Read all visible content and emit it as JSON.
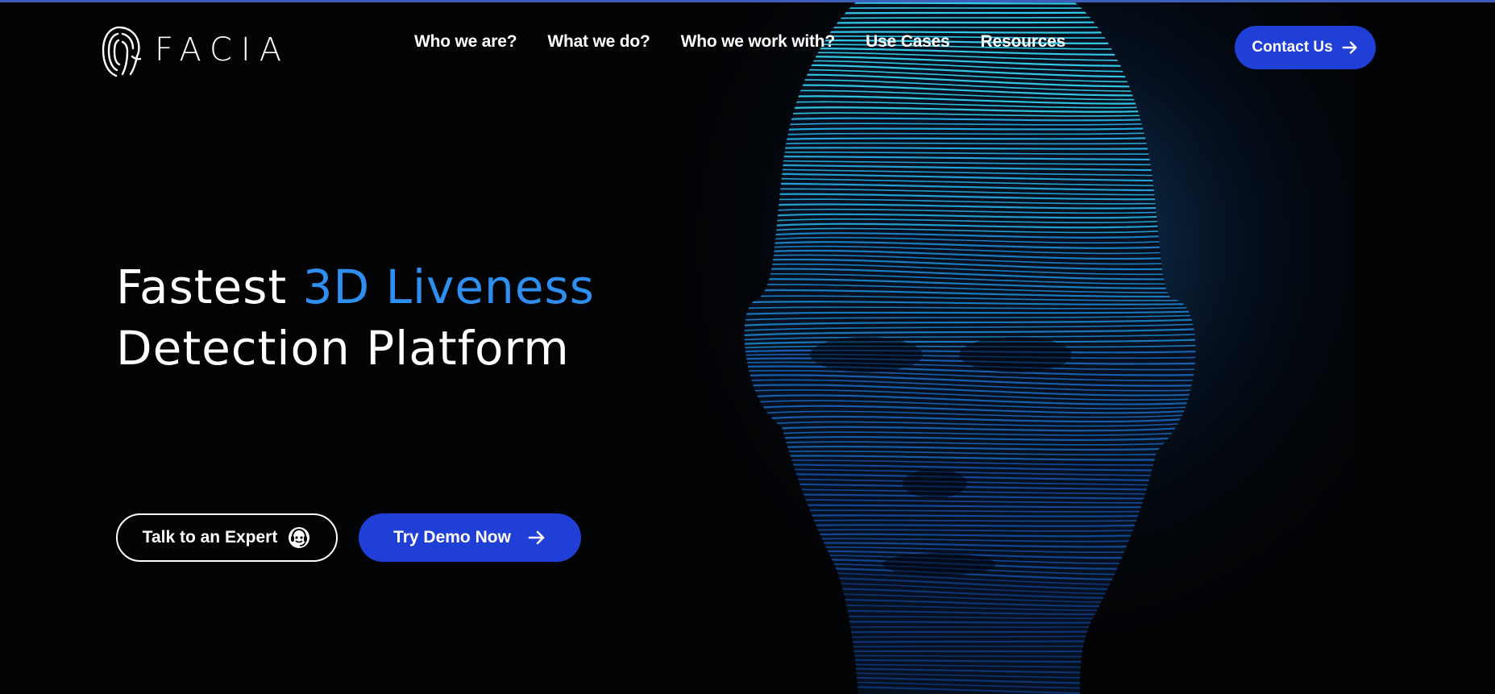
{
  "brand": {
    "name": "FACIA",
    "logo_icon": "fingerprint-face-icon",
    "accent_color": "#2e8ff0",
    "button_color": "#1f3fd6"
  },
  "nav": {
    "items": [
      {
        "label": "Who we are?"
      },
      {
        "label": "What we do?"
      },
      {
        "label": "Who we work with?"
      },
      {
        "label": "Use Cases"
      },
      {
        "label": "Resources"
      }
    ],
    "contact_label": "Contact Us",
    "contact_icon": "arrow-right-icon"
  },
  "hero": {
    "title_part1": "Fastest ",
    "title_accent": "3D Liveness",
    "title_line2": "Detection Platform",
    "visual": "3d-wireframe-head-image",
    "expert_label": "Talk to an Expert",
    "expert_icon": "support-agent-icon",
    "demo_label": "Try Demo Now",
    "demo_icon": "arrow-right-icon"
  }
}
